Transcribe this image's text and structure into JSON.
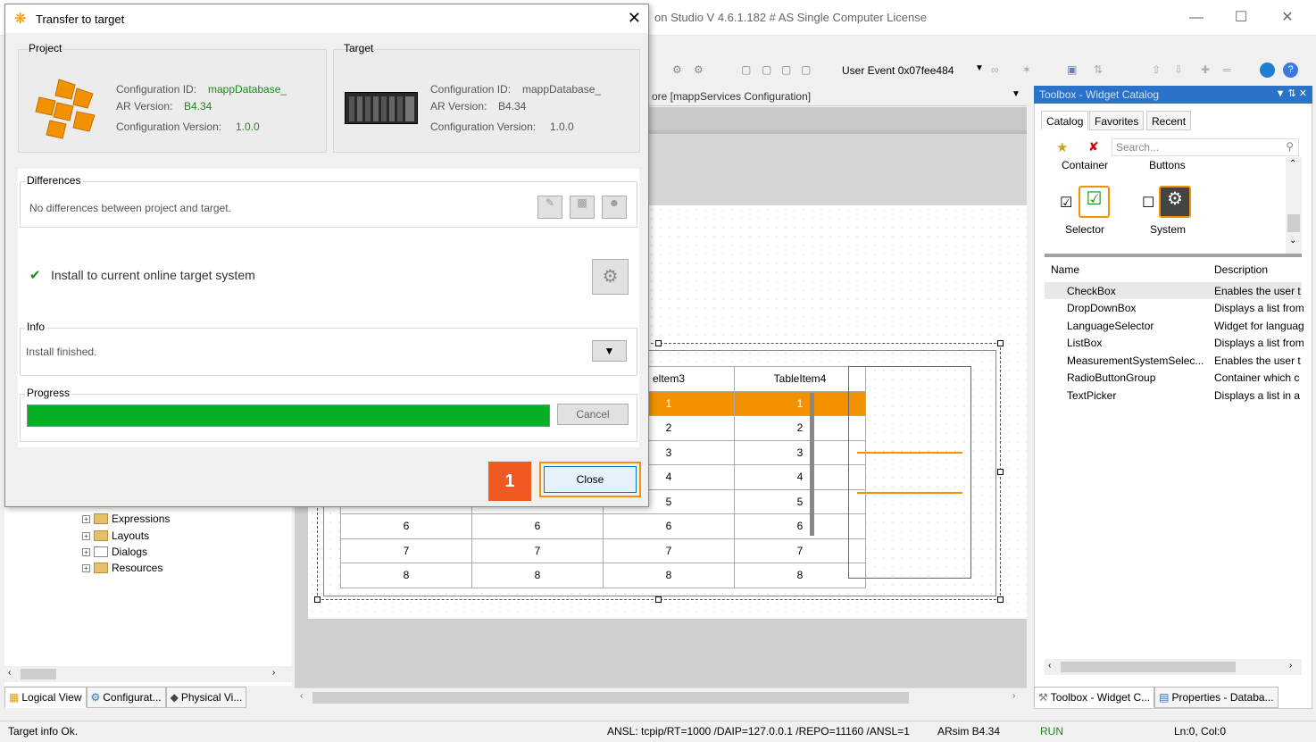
{
  "window": {
    "title": "on Studio V 4.6.1.182 # AS Single Computer License",
    "user_event": "User Event 0x07fee484"
  },
  "editor": {
    "doc_tab": "ore [mappServices Configuration]",
    "table": {
      "headers": [
        "",
        "",
        "eltem3",
        "TableItem4"
      ],
      "rows": [
        [
          "",
          "",
          "1",
          "1"
        ],
        [
          "",
          "",
          "2",
          "2"
        ],
        [
          "",
          "",
          "3",
          "3"
        ],
        [
          "",
          "",
          "4",
          "4"
        ],
        [
          "",
          "",
          "5",
          "5"
        ],
        [
          "6",
          "6",
          "6",
          "6"
        ],
        [
          "7",
          "7",
          "7",
          "7"
        ],
        [
          "8",
          "8",
          "8",
          "8"
        ]
      ]
    }
  },
  "tree": {
    "items": [
      "Expressions",
      "Layouts",
      "Dialogs",
      "Resources"
    ]
  },
  "left_tabs": [
    "Logical View",
    "Configurat...",
    "Physical Vi..."
  ],
  "toolbox": {
    "title": "Toolbox - Widget Catalog",
    "tabs": [
      "Catalog",
      "Favorites",
      "Recent"
    ],
    "search_placeholder": "Search...",
    "categories_top": [
      "Container",
      "Buttons"
    ],
    "widgets": [
      "Selector",
      "System"
    ],
    "list_headers": {
      "name": "Name",
      "description": "Description"
    },
    "list": [
      {
        "name": "CheckBox",
        "desc": "Enables the user t"
      },
      {
        "name": "DropDownBox",
        "desc": "Displays a list from"
      },
      {
        "name": "LanguageSelector",
        "desc": "Widget for languag"
      },
      {
        "name": "ListBox",
        "desc": "Displays a list from"
      },
      {
        "name": "MeasurementSystemSelec...",
        "desc": "Enables the user t"
      },
      {
        "name": "RadioButtonGroup",
        "desc": "Container which c"
      },
      {
        "name": "TextPicker",
        "desc": "Displays a list in a"
      }
    ]
  },
  "right_tabs": [
    "Toolbox - Widget C...",
    "Properties - Databa..."
  ],
  "status": {
    "left": "Target info Ok.",
    "connection": "ANSL: tcpip/RT=1000 /DAIP=127.0.0.1 /REPO=11160 /ANSL=1",
    "target": "ARsim  B4.34",
    "mode": "RUN",
    "position": "Ln:0, Col:0"
  },
  "dialog": {
    "title": "Transfer to target",
    "project": {
      "label": "Project",
      "config_id_label": "Configuration ID:",
      "config_id": "mappDatabase_",
      "ar_version_label": "AR Version:",
      "ar_version": "B4.34",
      "config_version_label": "Configuration Version:",
      "config_version": "1.0.0"
    },
    "target": {
      "label": "Target",
      "config_id_label": "Configuration ID:",
      "config_id": "mappDatabase_",
      "ar_version_label": "AR Version:",
      "ar_version": "B4.34",
      "config_version_label": "Configuration Version:",
      "config_version": "1.0.0"
    },
    "differences": {
      "label": "Differences",
      "text": "No differences between project and target."
    },
    "install_text": "Install to current online target system",
    "info": {
      "label": "Info",
      "text": "Install finished."
    },
    "progress": {
      "label": "Progress",
      "value": 1.0,
      "cancel": "Cancel"
    },
    "close": "Close",
    "badge": "1"
  },
  "colors": {
    "accent_orange": "#f39200",
    "badge": "#f05a22",
    "progress_green": "#06b025",
    "toolbox_header": "#2b73c8"
  }
}
